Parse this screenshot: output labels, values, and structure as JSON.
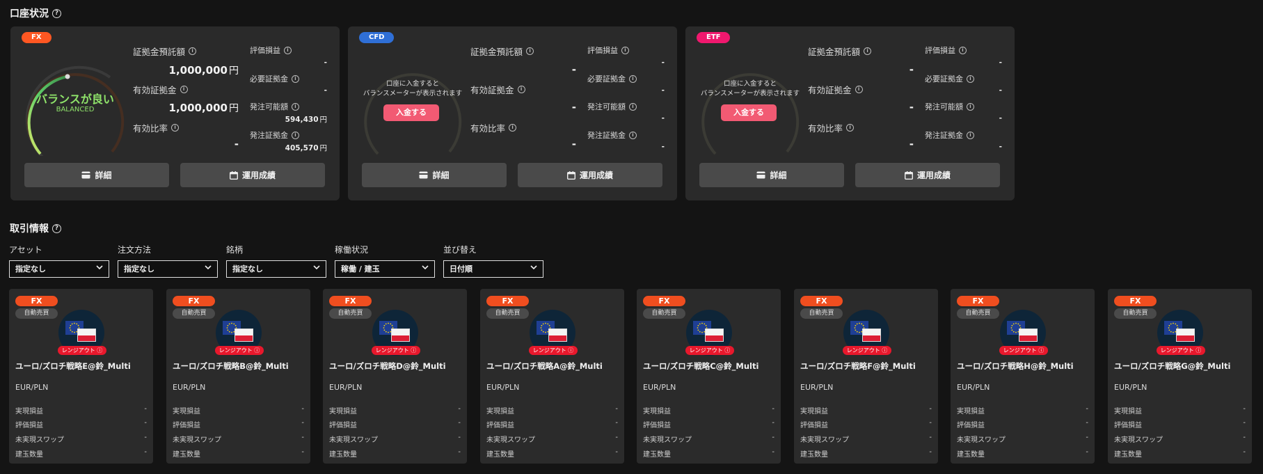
{
  "account_section": {
    "title": "口座状況"
  },
  "accounts": [
    {
      "badge": "FX",
      "badge_color": "#ff5722",
      "balance_main": "バランスが良い",
      "balance_sub": "BALANCED",
      "deposit_label": "証拠金預託額",
      "deposit_value": "1,000,000",
      "deposit_unit": "円",
      "effective_margin_label": "有効証拠金",
      "effective_margin_value": "1,000,000",
      "effective_margin_unit": "円",
      "effective_ratio_label": "有効比率",
      "effective_ratio_value": "-",
      "unrealized_label": "評価損益",
      "unrealized_value": "-",
      "required_margin_label": "必要証拠金",
      "required_margin_value": "-",
      "available_label": "発注可能額",
      "available_value": "594,430",
      "available_unit": "円",
      "order_margin_label": "発注証拠金",
      "order_margin_value": "405,570",
      "order_margin_unit": "円",
      "detail_button": "詳細",
      "performance_button": "運用成績"
    },
    {
      "badge": "CFD",
      "badge_color": "#2f6fd6",
      "gauge_message_1": "口座に入金すると",
      "gauge_message_2": "バランスメーターが表示されます",
      "deposit_button": "入金する",
      "deposit_label": "証拠金預託額",
      "deposit_value": "-",
      "effective_margin_label": "有効証拠金",
      "effective_margin_value": "-",
      "effective_ratio_label": "有効比率",
      "effective_ratio_value": "-",
      "unrealized_label": "評価損益",
      "unrealized_value": "-",
      "required_margin_label": "必要証拠金",
      "required_margin_value": "-",
      "available_label": "発注可能額",
      "available_value": "-",
      "order_margin_label": "発注証拠金",
      "order_margin_value": "-",
      "detail_button": "詳細",
      "performance_button": "運用成績"
    },
    {
      "badge": "ETF",
      "badge_color": "#f0186e",
      "gauge_message_1": "口座に入金すると",
      "gauge_message_2": "バランスメーターが表示されます",
      "deposit_button": "入金する",
      "deposit_label": "証拠金預託額",
      "deposit_value": "-",
      "effective_margin_label": "有効証拠金",
      "effective_margin_value": "-",
      "effective_ratio_label": "有効比率",
      "effective_ratio_value": "-",
      "unrealized_label": "評価損益",
      "unrealized_value": "-",
      "required_margin_label": "必要証拠金",
      "required_margin_value": "-",
      "available_label": "発注可能額",
      "available_value": "-",
      "order_margin_label": "発注証拠金",
      "order_margin_value": "-",
      "detail_button": "詳細",
      "performance_button": "運用成績"
    }
  ],
  "trade_section": {
    "title": "取引情報"
  },
  "filters": [
    {
      "label": "アセット",
      "value": "指定なし"
    },
    {
      "label": "注文方法",
      "value": "指定なし"
    },
    {
      "label": "銘柄",
      "value": "指定なし"
    },
    {
      "label": "稼働状況",
      "value": "稼働 / 建玉"
    },
    {
      "label": "並び替え",
      "value": "日付順"
    }
  ],
  "trade_card_labels": {
    "badge": "FX",
    "type": "自動売買",
    "range": "レンジアウト",
    "pair": "EUR/PLN",
    "realized": "実現損益",
    "unrealized": "評価損益",
    "swap": "未実現スワップ",
    "position": "建玉数量"
  },
  "trade_cards": [
    {
      "name": "ユーロ/ズロチ戦略E@鈴_Multi",
      "realized": "-",
      "unrealized": "-",
      "swap": "-",
      "position": "-"
    },
    {
      "name": "ユーロ/ズロチ戦略B@鈴_Multi",
      "realized": "-",
      "unrealized": "-",
      "swap": "-",
      "position": "-"
    },
    {
      "name": "ユーロ/ズロチ戦略D@鈴_Multi",
      "realized": "-",
      "unrealized": "-",
      "swap": "-",
      "position": "-"
    },
    {
      "name": "ユーロ/ズロチ戦略A@鈴_Multi",
      "realized": "-",
      "unrealized": "-",
      "swap": "-",
      "position": "-"
    },
    {
      "name": "ユーロ/ズロチ戦略C@鈴_Multi",
      "realized": "-",
      "unrealized": "-",
      "swap": "-",
      "position": "-"
    },
    {
      "name": "ユーロ/ズロチ戦略F@鈴_Multi",
      "realized": "-",
      "unrealized": "-",
      "swap": "-",
      "position": "-"
    },
    {
      "name": "ユーロ/ズロチ戦略H@鈴_Multi",
      "realized": "-",
      "unrealized": "-",
      "swap": "-",
      "position": "-"
    },
    {
      "name": "ユーロ/ズロチ戦略G@鈴_Multi",
      "realized": "-",
      "unrealized": "-",
      "swap": "-",
      "position": "-"
    }
  ]
}
